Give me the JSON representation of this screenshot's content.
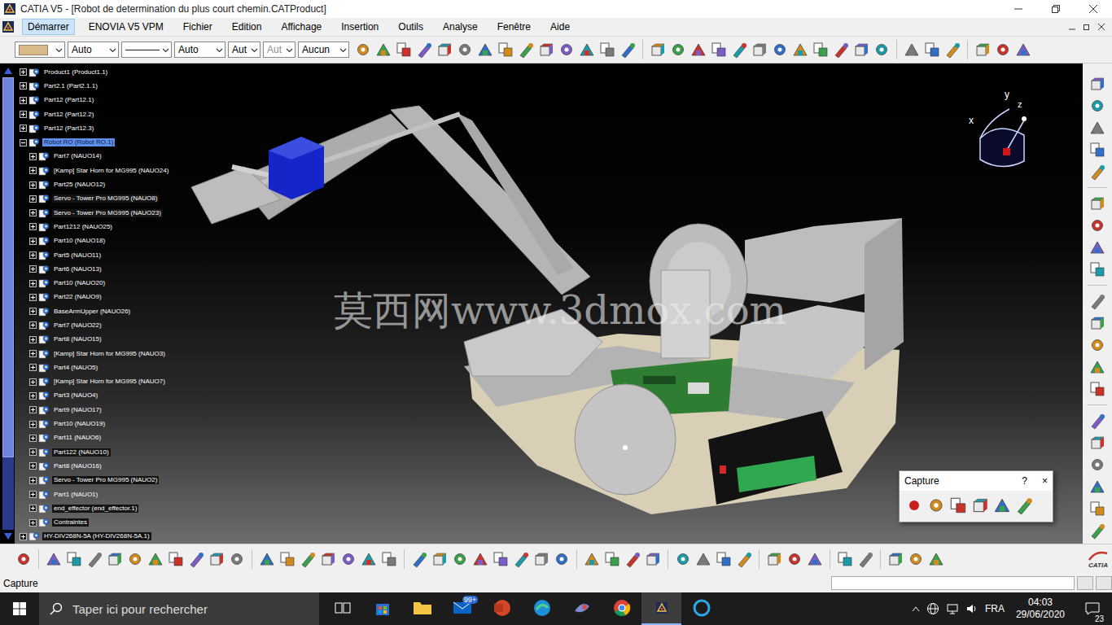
{
  "window": {
    "title": "CATIA V5 - [Robot de determination du plus court chemin.CATProduct]"
  },
  "menu": [
    {
      "label": "Démarrer",
      "selected": true
    },
    {
      "label": "ENOVIA V5 VPM",
      "selected": false
    },
    {
      "label": "Fichier",
      "selected": false
    },
    {
      "label": "Edition",
      "selected": false
    },
    {
      "label": "Affichage",
      "selected": false
    },
    {
      "label": "Insertion",
      "selected": false
    },
    {
      "label": "Outils",
      "selected": false
    },
    {
      "label": "Analyse",
      "selected": false
    },
    {
      "label": "Fenêtre",
      "selected": false
    },
    {
      "label": "Aide",
      "selected": false
    }
  ],
  "property_fields": [
    {
      "kind": "swatch",
      "value": "",
      "disabled": false
    },
    {
      "kind": "text",
      "value": "Auto",
      "disabled": false
    },
    {
      "kind": "line",
      "value": "",
      "disabled": false
    },
    {
      "kind": "text",
      "value": "Auto",
      "disabled": false
    },
    {
      "kind": "text",
      "value": "Aut",
      "disabled": false
    },
    {
      "kind": "text",
      "value": "Aut",
      "disabled": true
    },
    {
      "kind": "text",
      "value": "Aucun",
      "disabled": false
    }
  ],
  "tree": {
    "scrollbar": {
      "level": 0.84
    },
    "items": [
      {
        "label": "Product1 (Product1.1)",
        "depth": 0,
        "expanded": false,
        "selected": false,
        "boxed": false
      },
      {
        "label": "Part2.1 (Part2.1.1)",
        "depth": 0,
        "expanded": false,
        "selected": false,
        "boxed": false
      },
      {
        "label": "Part12 (Part12.1)",
        "depth": 0,
        "expanded": false,
        "selected": false,
        "boxed": false
      },
      {
        "label": "Part12 (Part12.2)",
        "depth": 0,
        "expanded": false,
        "selected": false,
        "boxed": false
      },
      {
        "label": "Part12 (Part12.3)",
        "depth": 0,
        "expanded": false,
        "selected": false,
        "boxed": false
      },
      {
        "label": "Robot RO (Robot RO.1)",
        "depth": 0,
        "expanded": true,
        "selected": true,
        "boxed": false
      },
      {
        "label": "Part7 (NAUO14)",
        "depth": 1,
        "expanded": false,
        "selected": false,
        "boxed": false
      },
      {
        "label": "[Kamp] Star Horn for MG995 (NAUO24)",
        "depth": 1,
        "expanded": false,
        "selected": false,
        "boxed": false
      },
      {
        "label": "Part25 (NAUO12)",
        "depth": 1,
        "expanded": false,
        "selected": false,
        "boxed": false
      },
      {
        "label": "Servo - Tower Pro MG995 (NAUO8)",
        "depth": 1,
        "expanded": false,
        "selected": false,
        "boxed": true
      },
      {
        "label": "Servo - Tower Pro MG995 (NAUO23)",
        "depth": 1,
        "expanded": false,
        "selected": false,
        "boxed": true
      },
      {
        "label": "Part1212 (NAUO25)",
        "depth": 1,
        "expanded": false,
        "selected": false,
        "boxed": false
      },
      {
        "label": "Part10 (NAUO18)",
        "depth": 1,
        "expanded": false,
        "selected": false,
        "boxed": false
      },
      {
        "label": "Part5 (NAUO11)",
        "depth": 1,
        "expanded": false,
        "selected": false,
        "boxed": false
      },
      {
        "label": "Part6 (NAUO13)",
        "depth": 1,
        "expanded": false,
        "selected": false,
        "boxed": false
      },
      {
        "label": "Part10 (NAUO20)",
        "depth": 1,
        "expanded": false,
        "selected": false,
        "boxed": false
      },
      {
        "label": "Part22 (NAUO9)",
        "depth": 1,
        "expanded": false,
        "selected": false,
        "boxed": false
      },
      {
        "label": "BaseArmUpper (NAUO26)",
        "depth": 1,
        "expanded": false,
        "selected": false,
        "boxed": false
      },
      {
        "label": "Part7 (NAUO22)",
        "depth": 1,
        "expanded": false,
        "selected": false,
        "boxed": false
      },
      {
        "label": "Part8 (NAUO15)",
        "depth": 1,
        "expanded": false,
        "selected": false,
        "boxed": false
      },
      {
        "label": "[Kamp] Star Horn for MG995 (NAUO3)",
        "depth": 1,
        "expanded": false,
        "selected": false,
        "boxed": false
      },
      {
        "label": "Part4 (NAUO5)",
        "depth": 1,
        "expanded": false,
        "selected": false,
        "boxed": false
      },
      {
        "label": "[Kamp] Star Horn for MG995 (NAUO7)",
        "depth": 1,
        "expanded": false,
        "selected": false,
        "boxed": false
      },
      {
        "label": "Part3 (NAUO4)",
        "depth": 1,
        "expanded": false,
        "selected": false,
        "boxed": false
      },
      {
        "label": "Part9 (NAUO17)",
        "depth": 1,
        "expanded": false,
        "selected": false,
        "boxed": false
      },
      {
        "label": "Part10 (NAUO19)",
        "depth": 1,
        "expanded": false,
        "selected": false,
        "boxed": false
      },
      {
        "label": "Part11 (NAUO6)",
        "depth": 1,
        "expanded": false,
        "selected": false,
        "boxed": false
      },
      {
        "label": "Part122 (NAUO10)",
        "depth": 1,
        "expanded": false,
        "selected": false,
        "boxed": true
      },
      {
        "label": "Part8 (NAUO16)",
        "depth": 1,
        "expanded": false,
        "selected": false,
        "boxed": false
      },
      {
        "label": "Servo - Tower Pro MG995 (NAUO2)",
        "depth": 1,
        "expanded": false,
        "selected": false,
        "boxed": true
      },
      {
        "label": "Part1 (NAUO1)",
        "depth": 1,
        "expanded": false,
        "selected": false,
        "boxed": false
      },
      {
        "label": "end_effector (end_effector.1)",
        "depth": 1,
        "expanded": false,
        "selected": false,
        "boxed": true
      },
      {
        "label": "Contraintes",
        "depth": 1,
        "expanded": false,
        "selected": false,
        "boxed": true
      },
      {
        "label": "HY-DIV268N-5A (HY-DIV268N-5A.1)",
        "depth": 0,
        "expanded": false,
        "selected": false,
        "boxed": true
      }
    ]
  },
  "viewport": {
    "watermark": "莫西网www.3dmox.com",
    "compass": {
      "x": "x",
      "y": "y",
      "z": "z"
    }
  },
  "capture_dialog": {
    "title": "Capture",
    "help": "?",
    "close": "×"
  },
  "logo": "CATIA",
  "status_bar": {
    "text": "Capture"
  },
  "taskbar": {
    "search": "Taper ici pour rechercher",
    "mail_badge": "99+",
    "language": "FRA",
    "time": "04:03",
    "date": "29/06/2020",
    "notifications": "23"
  }
}
